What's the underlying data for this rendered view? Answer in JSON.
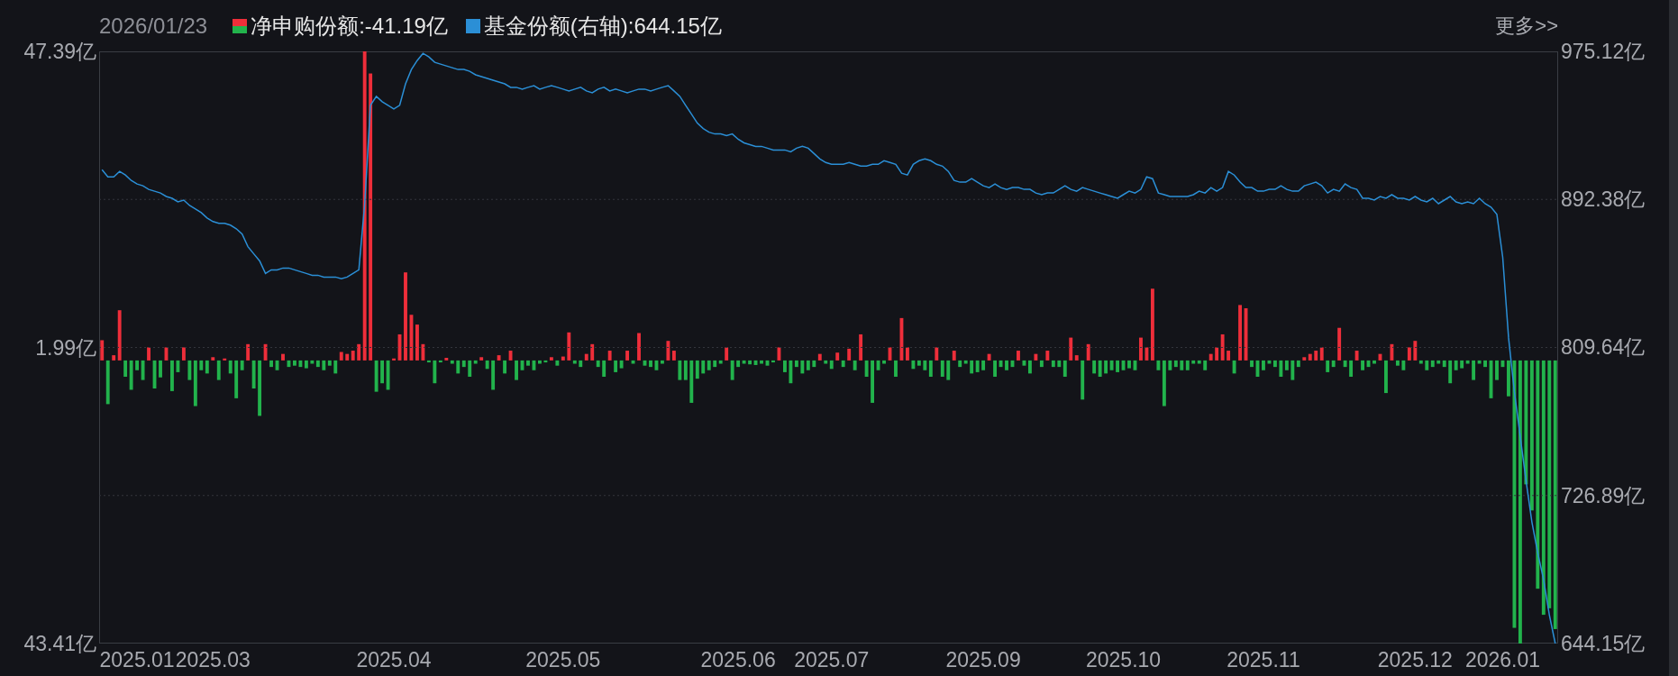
{
  "header": {
    "date": "2026/01/23",
    "legend": [
      {
        "value": ":-41.19亿"
      },
      {
        "value": ":644.15亿"
      }
    ],
    "more_link": "更多>>"
  },
  "net_subscription": {
    "chart_data": {
      "type": "bar",
      "categories": [
        null,
        null,
        null,
        null,
        null,
        null,
        "2025.01",
        null,
        null,
        null,
        null,
        null,
        null,
        null,
        null,
        null,
        null,
        null,
        null,
        "2025.03",
        null,
        null,
        null,
        null,
        null,
        null,
        null,
        null,
        null,
        null,
        null,
        null,
        null,
        null,
        null,
        null,
        null,
        null,
        null,
        null,
        null,
        null,
        null,
        null,
        null,
        null,
        null,
        null,
        null,
        null,
        "2025.04",
        null,
        null,
        null,
        null,
        null,
        null,
        null,
        null,
        null,
        null,
        null,
        null,
        null,
        null,
        null,
        null,
        null,
        null,
        null,
        null,
        null,
        null,
        null,
        null,
        null,
        null,
        null,
        null,
        "2025.05",
        null,
        null,
        null,
        null,
        null,
        null,
        null,
        null,
        null,
        null,
        null,
        null,
        null,
        null,
        null,
        null,
        null,
        null,
        null,
        null,
        null,
        null,
        null,
        null,
        null,
        null,
        null,
        null,
        null,
        "2025.06",
        null,
        null,
        null,
        null,
        null,
        null,
        null,
        null,
        null,
        null,
        null,
        null,
        null,
        null,
        null,
        "2025.07",
        null,
        null,
        null,
        null,
        null,
        null,
        null,
        null,
        null,
        null,
        null,
        null,
        null,
        null,
        null,
        null,
        null,
        null,
        null,
        null,
        null,
        null,
        null,
        null,
        null,
        "2025.09",
        null,
        null,
        null,
        null,
        null,
        null,
        null,
        null,
        null,
        null,
        null,
        null,
        null,
        null,
        null,
        null,
        null,
        null,
        null,
        null,
        null,
        null,
        null,
        "2025.10",
        null,
        null,
        null,
        null,
        null,
        null,
        null,
        null,
        null,
        null,
        null,
        null,
        null,
        null,
        null,
        null,
        null,
        null,
        null,
        null,
        null,
        null,
        null,
        "2025.11",
        null,
        null,
        null,
        null,
        null,
        null,
        null,
        null,
        null,
        null,
        null,
        null,
        null,
        null,
        null,
        null,
        null,
        null,
        null,
        null,
        null,
        null,
        null,
        null,
        null,
        "2025.12",
        null,
        null,
        null,
        null,
        null,
        null,
        null,
        null,
        null,
        null,
        null,
        null,
        null,
        null,
        "2026.01",
        null,
        null,
        null,
        null,
        null,
        null,
        null,
        null,
        null
      ],
      "ylim": [
        -43.41,
        47.39
      ],
      "yticks": [
        {
          "value": 47.39,
          "label": "47.39亿"
        },
        {
          "value": 1.99,
          "label": "1.99亿"
        },
        {
          "value": -43.41,
          "label": "43.41亿"
        }
      ],
      "series": [
        {
          "name": "净申购份额",
          "values": [
            3.1,
            -6.7,
            0.8,
            7.7,
            -2.5,
            -4.5,
            -1.5,
            -3.0,
            2.0,
            -4.3,
            -2.6,
            2.0,
            -4.7,
            -1.8,
            2.0,
            -3.0,
            -7.0,
            -1.5,
            -2.0,
            0.5,
            -3.0,
            0.3,
            -2.0,
            -5.8,
            -1.5,
            2.5,
            -4.3,
            -8.5,
            2.5,
            -1.0,
            -1.5,
            1.0,
            -1.0,
            -0.8,
            -1.0,
            -1.2,
            -0.5,
            -1.0,
            -1.5,
            -0.8,
            -2.0,
            1.3,
            1.0,
            1.5,
            2.5,
            47.39,
            44.0,
            -4.8,
            -3.5,
            -4.5,
            0.3,
            4.0,
            13.5,
            7.0,
            5.5,
            2.5,
            -0.3,
            -3.5,
            -0.3,
            0.4,
            -0.5,
            -2.0,
            -1.0,
            -2.5,
            -0.5,
            0.5,
            -1.3,
            -4.5,
            0.8,
            -2.0,
            1.5,
            -3.0,
            -1.5,
            -0.8,
            -1.5,
            -0.5,
            -0.3,
            0.5,
            -0.8,
            0.6,
            4.3,
            -0.5,
            -1.0,
            1.0,
            2.5,
            -1.0,
            -2.5,
            1.5,
            -1.8,
            -1.2,
            1.5,
            -0.5,
            4.2,
            -0.8,
            -1.0,
            -1.5,
            -0.5,
            3.0,
            1.5,
            -3.0,
            -3.0,
            -6.5,
            -2.8,
            -2.0,
            -1.5,
            -1.0,
            -0.5,
            2.0,
            -3.0,
            -1.0,
            -0.5,
            -0.6,
            -0.7,
            -0.5,
            -0.8,
            -0.3,
            2.0,
            -1.8,
            -3.5,
            -1.0,
            -2.0,
            -1.5,
            -1.0,
            1.0,
            -0.5,
            -1.3,
            1.2,
            -1.0,
            1.8,
            -1.5,
            4.0,
            -2.5,
            -6.5,
            -1.5,
            -0.5,
            2.0,
            -2.5,
            6.5,
            2.0,
            -1.3,
            -0.8,
            -1.5,
            -2.5,
            2.0,
            -2.5,
            -3.0,
            1.5,
            -1.0,
            -0.5,
            -2.0,
            -1.8,
            -1.5,
            1.0,
            -2.5,
            -1.0,
            -1.5,
            -1.0,
            1.5,
            -0.8,
            -2.0,
            1.0,
            -1.0,
            1.5,
            -1.0,
            -1.0,
            -2.5,
            3.5,
            0.8,
            -6.0,
            2.5,
            -2.0,
            -2.5,
            -2.0,
            -1.5,
            -1.8,
            -1.5,
            -1.2,
            -1.5,
            3.5,
            2.0,
            11.0,
            -1.5,
            -7.0,
            -1.5,
            -1.0,
            -1.5,
            -1.5,
            -0.5,
            -0.5,
            -1.5,
            1.0,
            2.0,
            4.0,
            1.5,
            -2.0,
            8.5,
            8.0,
            -1.0,
            -2.5,
            -1.5,
            -0.5,
            -1.0,
            -2.5,
            -1.5,
            -3.0,
            -1.0,
            0.5,
            1.0,
            1.5,
            2.0,
            -1.8,
            -1.0,
            5.0,
            -1.0,
            -2.5,
            1.5,
            -1.5,
            -1.0,
            -0.5,
            1.0,
            -5.0,
            2.5,
            -0.8,
            -1.5,
            2.0,
            3.0,
            -0.5,
            -1.5,
            -1.0,
            -0.5,
            -1.0,
            -3.5,
            -1.5,
            -1.2,
            -0.5,
            -3.0,
            -0.5,
            -1.0,
            -5.8,
            -3.0,
            -1.0,
            -5.5,
            -41.0,
            -43.41,
            -19.0,
            -23.0,
            -35.0,
            -39.0,
            -38.0,
            -41.19
          ]
        }
      ]
    }
  },
  "fund_shares": {
    "chart_data": {
      "type": "line",
      "grid": true,
      "ylim": [
        644.15,
        975.12
      ],
      "yticks": [
        {
          "value": 975.12,
          "label": "975.12亿"
        },
        {
          "value": 892.38,
          "label": "892.38亿"
        },
        {
          "value": 809.64,
          "label": "809.64亿"
        },
        {
          "value": 726.89,
          "label": "726.89亿"
        },
        {
          "value": 644.15,
          "label": "644.15亿"
        }
      ],
      "series": [
        {
          "name": "基金份额(右轴)",
          "color": "#2b8fd6",
          "values": [
            909,
            905,
            905,
            908,
            906,
            903,
            901,
            900,
            898,
            897,
            896,
            894,
            893,
            891,
            892,
            889,
            887,
            885,
            882,
            880,
            879,
            879,
            878,
            876,
            873,
            866,
            862,
            858,
            851,
            853,
            853,
            854,
            854,
            853,
            852,
            851,
            850,
            850,
            849,
            849,
            849,
            848,
            849,
            851,
            853,
            890,
            945,
            950,
            947,
            945,
            943,
            945,
            957,
            965,
            970,
            974,
            972,
            969,
            968,
            967,
            966,
            965,
            965,
            964,
            962,
            961,
            960,
            959,
            958,
            957,
            955,
            955,
            954,
            955,
            956,
            954,
            955,
            956,
            955,
            954,
            953,
            954,
            955,
            953,
            952,
            954,
            955,
            953,
            954,
            953,
            952,
            953,
            954,
            954,
            953,
            954,
            955,
            956,
            953,
            950,
            945,
            940,
            935,
            932,
            930,
            929,
            929,
            928,
            929,
            926,
            924,
            923,
            922,
            922,
            921,
            920,
            920,
            920,
            919,
            921,
            922,
            921,
            918,
            915,
            913,
            912,
            912,
            912,
            913,
            912,
            911,
            911,
            912,
            912,
            914,
            913,
            912,
            907,
            906,
            912,
            914,
            915,
            914,
            912,
            911,
            908,
            903,
            902,
            902,
            904,
            902,
            900,
            899,
            901,
            899,
            898,
            899,
            899,
            898,
            898,
            896,
            895,
            896,
            896,
            898,
            900,
            898,
            897,
            899,
            898,
            897,
            896,
            895,
            894,
            893,
            895,
            897,
            896,
            898,
            905,
            904,
            896,
            895,
            894,
            894,
            894,
            894,
            895,
            897,
            896,
            899,
            897,
            899,
            908,
            906,
            902,
            899,
            899,
            897,
            897,
            898,
            898,
            900,
            898,
            897,
            897,
            900,
            901,
            902,
            900,
            896,
            898,
            897,
            901,
            899,
            898,
            893,
            893,
            892,
            894,
            893,
            895,
            893,
            893,
            892,
            894,
            892,
            891,
            893,
            890,
            892,
            894,
            891,
            890,
            891,
            890,
            893,
            890,
            888,
            884,
            860,
            815,
            785,
            760,
            735,
            712,
            695,
            680,
            660,
            644.15
          ]
        }
      ]
    }
  }
}
